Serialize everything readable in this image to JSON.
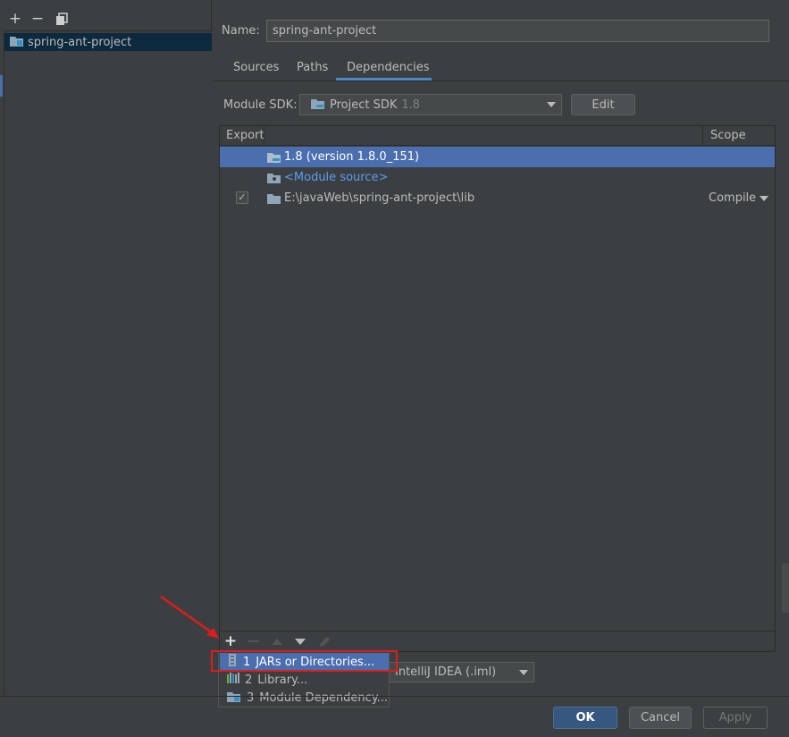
{
  "left": {
    "toolbar": {
      "add": "+",
      "remove": "−",
      "copy": "copy"
    },
    "tree_item": "spring-ant-project"
  },
  "name": {
    "label": "Name:",
    "value": "spring-ant-project"
  },
  "tabs": [
    {
      "label": "Sources",
      "active": false
    },
    {
      "label": "Paths",
      "active": false
    },
    {
      "label": "Dependencies",
      "active": true
    }
  ],
  "sdk": {
    "label": "Module SDK:",
    "value": "Project SDK",
    "version": "1.8",
    "edit": "Edit"
  },
  "table": {
    "headers": {
      "export": "Export",
      "scope": "Scope"
    },
    "rows": [
      {
        "text": "1.8 (version 1.8.0_151)",
        "icon": "jdk-folder-icon",
        "selected": true
      },
      {
        "text": "<Module source>",
        "icon": "folder-icon"
      },
      {
        "text": "E:\\javaWeb\\spring-ant-project\\lib",
        "icon": "folder-icon",
        "checked": true,
        "scope": "Compile"
      }
    ]
  },
  "toolbar": {
    "add": "+"
  },
  "popup": [
    {
      "num": "1",
      "label": "JARs or Directories...",
      "icon": "jar-icon"
    },
    {
      "num": "2",
      "label": "Library...",
      "icon": "library-icon"
    },
    {
      "num": "3",
      "label": "Module Dependency...",
      "icon": "module-icon"
    }
  ],
  "format": {
    "value": "IntelliJ IDEA (.iml)"
  },
  "buttons": {
    "ok": "OK",
    "cancel": "Cancel",
    "apply": "Apply"
  },
  "colors": {
    "selection": "#4b6eaf",
    "accent": "#4a88c7",
    "highlight": "#e01c1c",
    "link": "#589df6"
  }
}
